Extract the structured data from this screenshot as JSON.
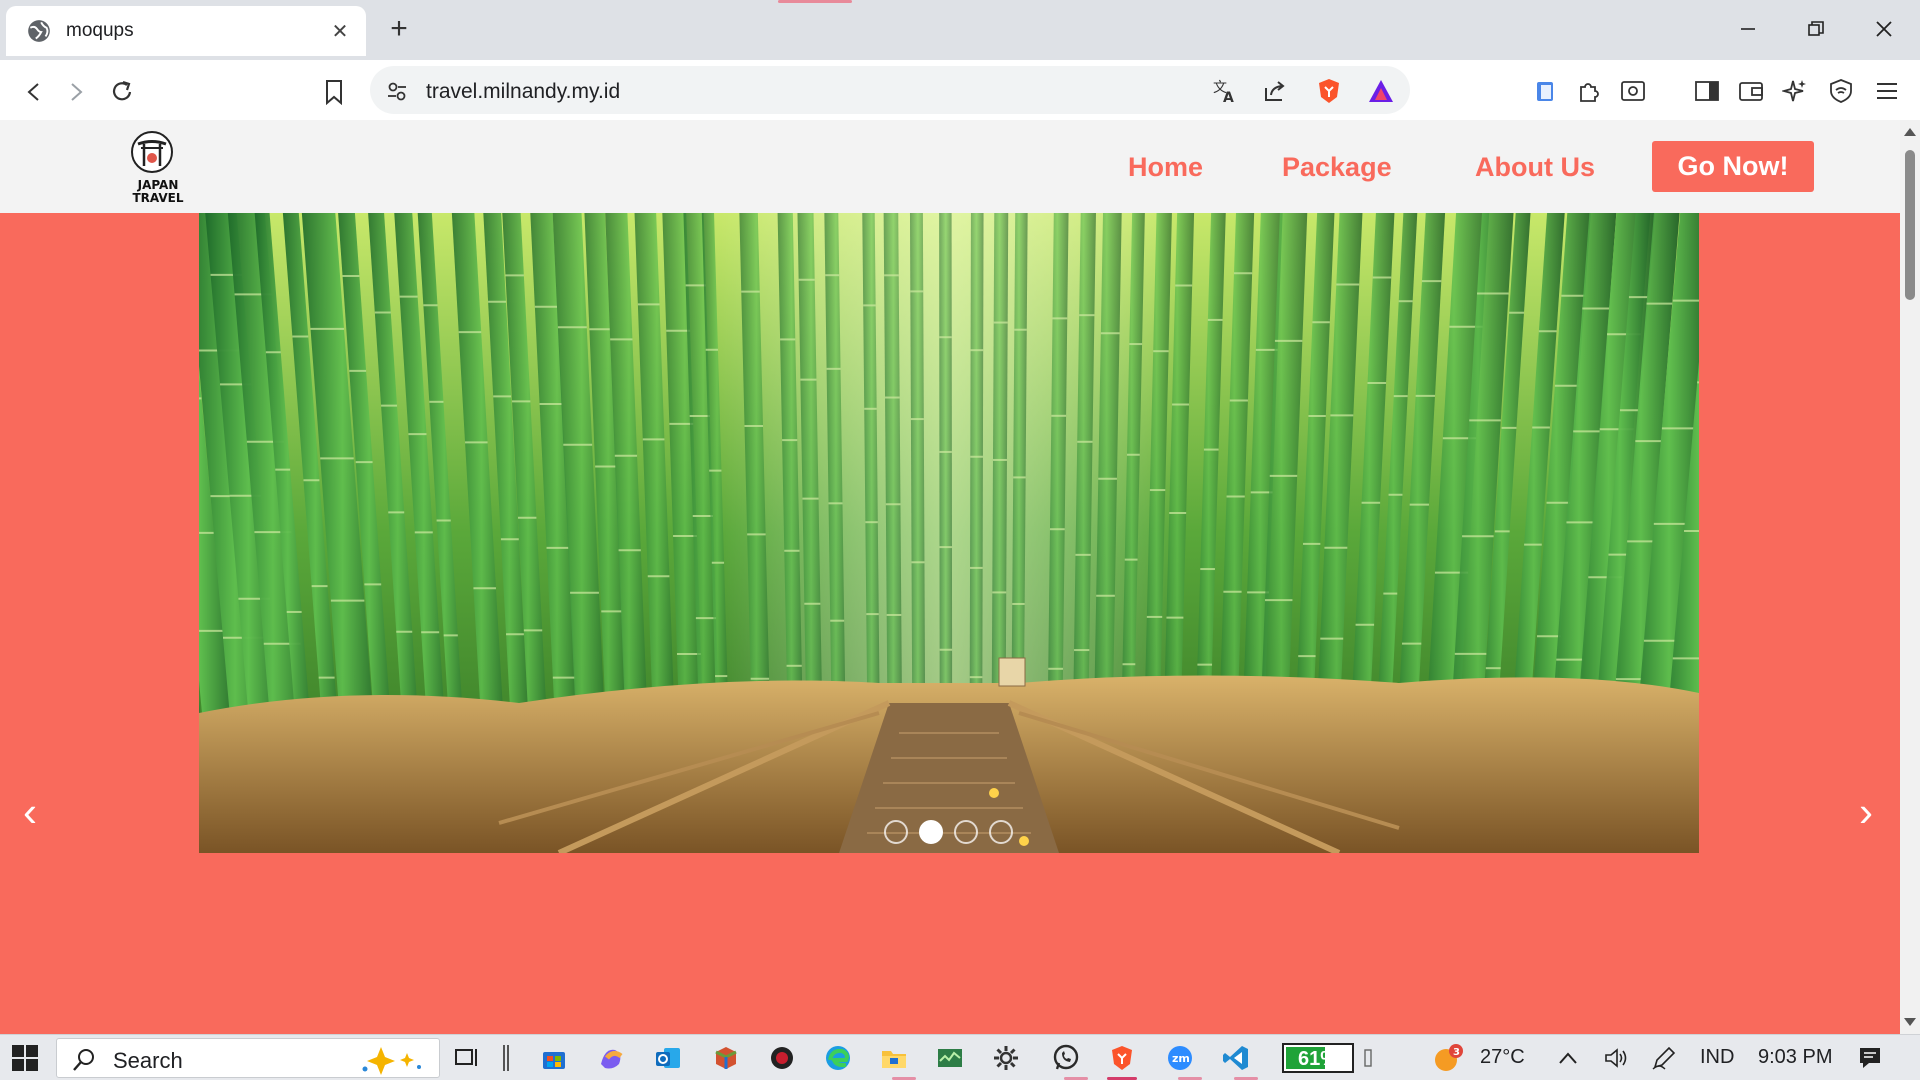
{
  "browser": {
    "tab_title": "moqups",
    "url": "travel.milnandy.my.id"
  },
  "site": {
    "logo_line1": "JAPAN",
    "logo_line2": "TRAVEL",
    "nav": {
      "home": "Home",
      "package": "Package",
      "about": "About Us",
      "cta": "Go Now!"
    },
    "carousel": {
      "slide_count": 4,
      "active_index": 1,
      "prev": "‹",
      "next": "›"
    }
  },
  "taskbar": {
    "search_label": "Search",
    "battery_percent": 61,
    "battery_label": "61%",
    "weather_badge": "3",
    "temperature": "27°C",
    "language": "IND",
    "time": "9:03 PM"
  },
  "colors": {
    "accent": "#f96a5c",
    "nav_bg": "#f3f3f3"
  }
}
